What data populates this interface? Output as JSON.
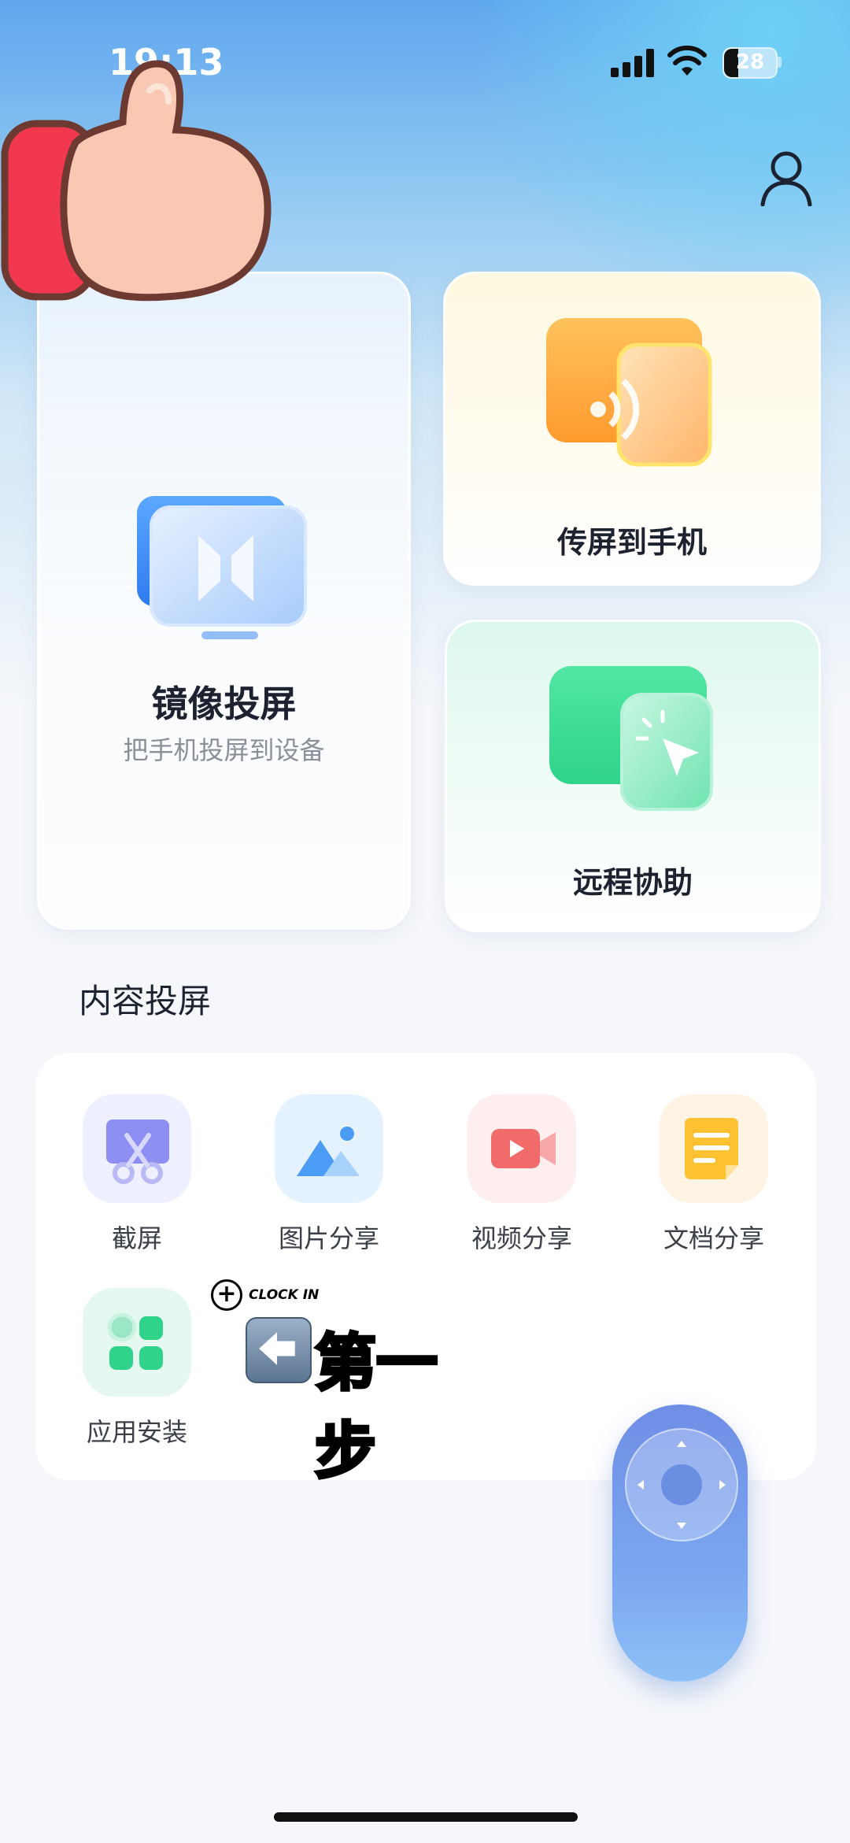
{
  "status_bar": {
    "time": "19:13",
    "battery": "28"
  },
  "cards": {
    "mirror": {
      "title": "镜像投屏",
      "subtitle": "把手机投屏到设备"
    },
    "to_phone": {
      "title": "传屏到手机"
    },
    "remote": {
      "title": "远程协助"
    }
  },
  "content_section": {
    "title": "内容投屏",
    "tools": [
      {
        "label": "截屏",
        "icon": "screenshot-scissors-icon"
      },
      {
        "label": "图片分享",
        "icon": "image-share-icon"
      },
      {
        "label": "视频分享",
        "icon": "video-share-icon"
      },
      {
        "label": "文档分享",
        "icon": "document-share-icon"
      },
      {
        "label": "应用安装",
        "icon": "app-install-icon"
      }
    ]
  },
  "overlay": {
    "clock_text": "CLOCK IN",
    "step_text": "第一步",
    "plus": "+"
  },
  "colors": {
    "accent_blue": "#6f8ee6",
    "orange": "#ffb347",
    "green": "#3ee29a",
    "video_red": "#f26b6b",
    "doc_yellow": "#ffc233"
  }
}
